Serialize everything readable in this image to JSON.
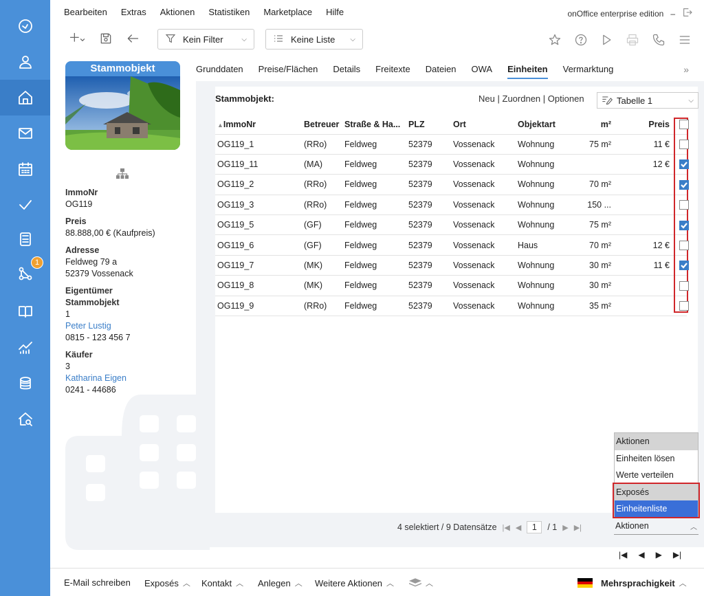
{
  "menu": [
    "Bearbeiten",
    "Extras",
    "Aktionen",
    "Statistiken",
    "Marketplace",
    "Hilfe"
  ],
  "edition": "onOffice enterprise edition",
  "edition_dash": "–",
  "toolbar": {
    "filter_label": "Kein Filter",
    "list_label": "Keine Liste"
  },
  "record": {
    "title": "Stammobjekt",
    "fields": [
      {
        "label": "ImmoNr",
        "lines": [
          "OG119"
        ]
      },
      {
        "label": "Preis",
        "lines": [
          "88.888,00 € (Kaufpreis)"
        ]
      },
      {
        "label": "Adresse",
        "lines": [
          "Feldweg 79 a",
          "52379 Vossenack"
        ]
      },
      {
        "label": "Eigentümer Stammobjekt",
        "lines": [
          "1"
        ],
        "link": "Peter Lustig",
        "extra": "0815 - 123 456 7"
      },
      {
        "label": "Käufer",
        "lines": [
          "3"
        ],
        "link": "Katharina Eigen",
        "extra": "0241 - 44686"
      }
    ]
  },
  "tabs": [
    "Grunddaten",
    "Preise/Flächen",
    "Details",
    "Freitexte",
    "Dateien",
    "OWA",
    "Einheiten",
    "Vermarktung"
  ],
  "active_tab": "Einheiten",
  "tab_more": "»",
  "units": {
    "title": "Stammobjekt:",
    "actions": {
      "new": "Neu",
      "assign": "Zuordnen",
      "options": "Optionen",
      "sep": "|"
    },
    "table_select": "Tabelle 1",
    "columns": [
      "ImmoNr",
      "Betreuer",
      "Straße & Ha...",
      "PLZ",
      "Ort",
      "Objektart",
      "m²",
      "Preis"
    ],
    "rows": [
      {
        "immonr": "OG119_1",
        "betreuer": "(RRo)",
        "strasse": "Feldweg",
        "plz": "52379",
        "ort": "Vossenack",
        "art": "Wohnung",
        "m2": "75 m²",
        "preis": "11 €",
        "checked": false
      },
      {
        "immonr": "OG119_11",
        "betreuer": "(MA)",
        "strasse": "Feldweg",
        "plz": "52379",
        "ort": "Vossenack",
        "art": "Wohnung",
        "m2": "",
        "preis": "12 €",
        "checked": true
      },
      {
        "immonr": "OG119_2",
        "betreuer": "(RRo)",
        "strasse": "Feldweg",
        "plz": "52379",
        "ort": "Vossenack",
        "art": "Wohnung",
        "m2": "70 m²",
        "preis": "",
        "checked": true
      },
      {
        "immonr": "OG119_3",
        "betreuer": "(RRo)",
        "strasse": "Feldweg",
        "plz": "52379",
        "ort": "Vossenack",
        "art": "Wohnung",
        "m2": "150 ...",
        "preis": "",
        "checked": false
      },
      {
        "immonr": "OG119_5",
        "betreuer": "(GF)",
        "strasse": "Feldweg",
        "plz": "52379",
        "ort": "Vossenack",
        "art": "Wohnung",
        "m2": "75 m²",
        "preis": "",
        "checked": true
      },
      {
        "immonr": "OG119_6",
        "betreuer": "(GF)",
        "strasse": "Feldweg",
        "plz": "52379",
        "ort": "Vossenack",
        "art": "Haus",
        "m2": "70 m²",
        "preis": "12 €",
        "checked": false
      },
      {
        "immonr": "OG119_7",
        "betreuer": "(MK)",
        "strasse": "Feldweg",
        "plz": "52379",
        "ort": "Vossenack",
        "art": "Wohnung",
        "m2": "30 m²",
        "preis": "11 €",
        "checked": true
      },
      {
        "immonr": "OG119_8",
        "betreuer": "(MK)",
        "strasse": "Feldweg",
        "plz": "52379",
        "ort": "Vossenack",
        "art": "Wohnung",
        "m2": "30 m²",
        "preis": "",
        "checked": false
      },
      {
        "immonr": "OG119_9",
        "betreuer": "(RRo)",
        "strasse": "Feldweg",
        "plz": "52379",
        "ort": "Vossenack",
        "art": "Wohnung",
        "m2": "35 m²",
        "preis": "",
        "checked": false
      }
    ]
  },
  "dropdown": [
    "Aktionen",
    "Einheiten lösen",
    "Werte verteilen",
    "Exposés",
    "Einheitenliste"
  ],
  "pager": {
    "status": "4 selektiert / 9 Datensätze",
    "page": "1",
    "of": "/ 1"
  },
  "actions_select": "Aktionen",
  "footer": [
    "E-Mail schreiben",
    "Exposés",
    "Kontakt",
    "Anlegen",
    "Weitere Aktionen"
  ],
  "footer_lang": "Mehrsprachigkeit",
  "badge": "1"
}
